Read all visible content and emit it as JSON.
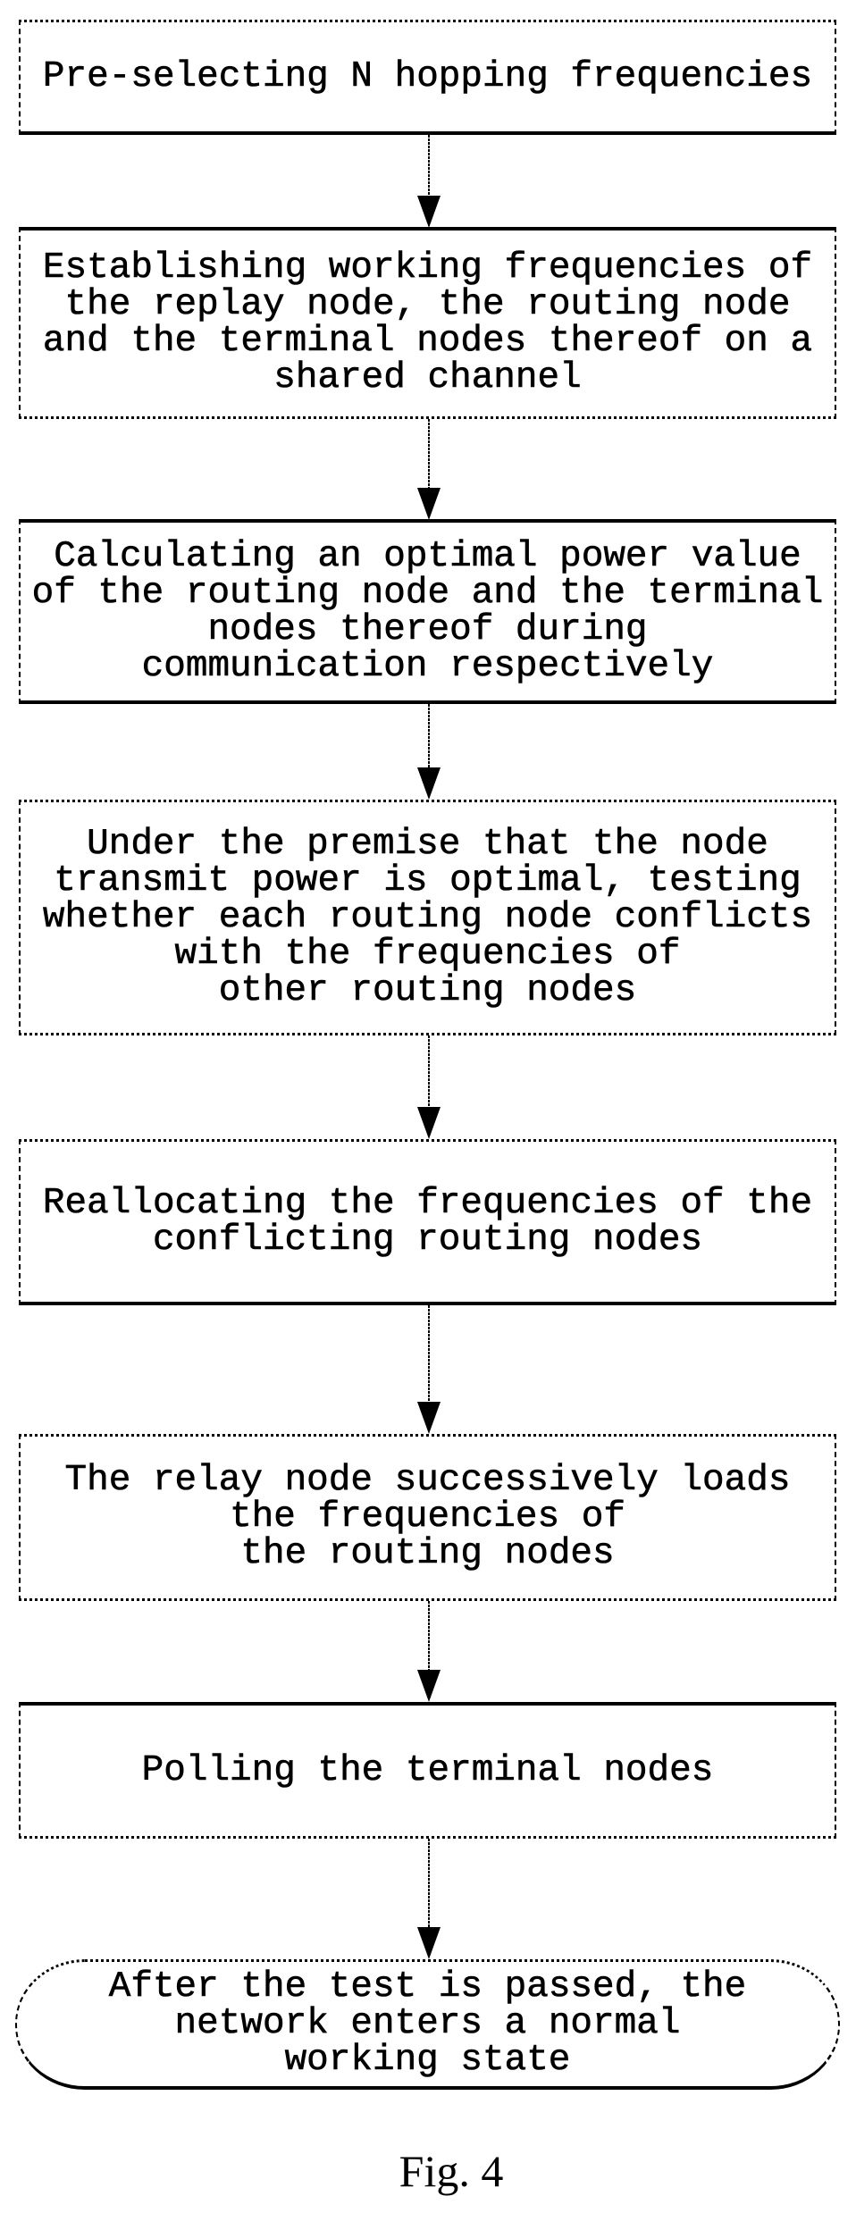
{
  "figure": {
    "caption": "Fig. 4",
    "steps": [
      {
        "id": "step-1",
        "shape": "process",
        "lines": [
          "Pre-selecting N hopping frequencies"
        ]
      },
      {
        "id": "step-2",
        "shape": "process",
        "lines": [
          "Establishing working frequencies of",
          "the replay node, the routing node",
          "and the terminal nodes thereof on a",
          "shared channel"
        ]
      },
      {
        "id": "step-3",
        "shape": "process",
        "lines": [
          "Calculating an optimal power value",
          "of the routing node and the terminal",
          "nodes thereof during",
          "communication respectively"
        ]
      },
      {
        "id": "step-4",
        "shape": "process",
        "lines": [
          "Under the premise that the node",
          "transmit power is optimal, testing",
          "whether each routing node conflicts",
          "with the frequencies of",
          "other routing nodes"
        ]
      },
      {
        "id": "step-5",
        "shape": "process",
        "lines": [
          "Reallocating the frequencies of the",
          "conflicting routing nodes"
        ]
      },
      {
        "id": "step-6",
        "shape": "process",
        "lines": [
          "The relay node successively loads",
          "the frequencies of",
          "the routing nodes"
        ]
      },
      {
        "id": "step-7",
        "shape": "process",
        "lines": [
          "Polling the terminal nodes"
        ]
      },
      {
        "id": "step-8",
        "shape": "terminal",
        "lines": [
          "After the test is passed, the",
          "network enters a normal",
          "working state"
        ]
      }
    ],
    "connectors": [
      {
        "from": "step-1",
        "to": "step-2",
        "icon": "arrow-down-icon"
      },
      {
        "from": "step-2",
        "to": "step-3",
        "icon": "arrow-down-icon"
      },
      {
        "from": "step-3",
        "to": "step-4",
        "icon": "arrow-down-icon"
      },
      {
        "from": "step-4",
        "to": "step-5",
        "icon": "arrow-down-icon"
      },
      {
        "from": "step-5",
        "to": "step-6",
        "icon": "arrow-down-icon"
      },
      {
        "from": "step-6",
        "to": "step-7",
        "icon": "arrow-down-icon"
      },
      {
        "from": "step-7",
        "to": "step-8",
        "icon": "arrow-down-icon"
      }
    ]
  }
}
